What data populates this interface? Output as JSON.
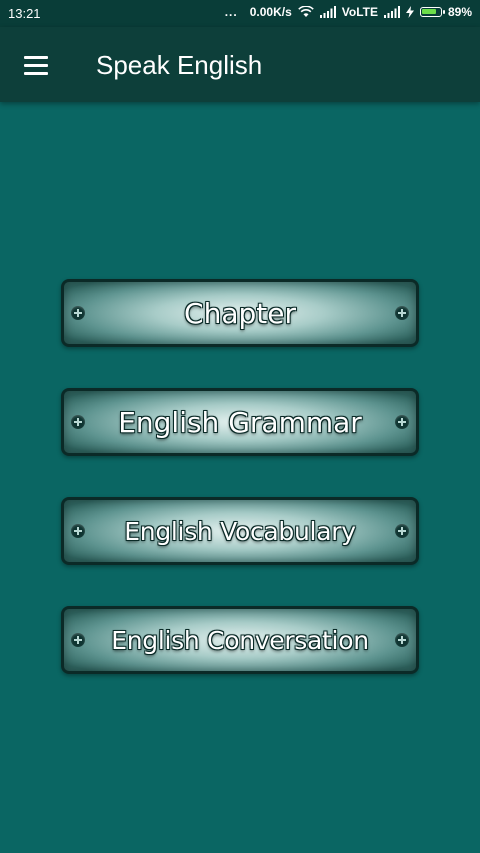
{
  "status_bar": {
    "time": "13:21",
    "dots": "...",
    "network_speed": "0.00K/s",
    "network_type": "VoLTE",
    "battery_percent": "89%",
    "battery_level": 0.89,
    "icons": [
      "wifi-icon",
      "signal-icon",
      "charging-icon",
      "battery-icon"
    ]
  },
  "toolbar": {
    "title": "Speak English",
    "menu_icon": "hamburger-menu-icon"
  },
  "menu": {
    "items": [
      {
        "label": "Chapter"
      },
      {
        "label": "English Grammar"
      },
      {
        "label": "English Vocabulary"
      },
      {
        "label": "English Conversation"
      }
    ]
  },
  "colors": {
    "background": "#0a6663",
    "toolbar": "#0d3f3a",
    "status_bar": "#093d38",
    "plate_border": "#0b2a27"
  }
}
